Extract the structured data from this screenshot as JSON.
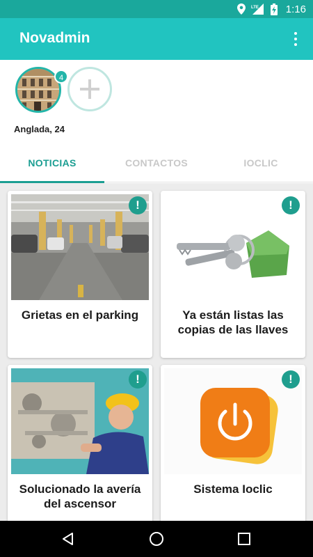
{
  "status_bar": {
    "time": "1:16",
    "network": "LTE",
    "icons": [
      "location-icon",
      "signal-icon",
      "battery-icon"
    ]
  },
  "app_bar": {
    "title": "Novadmin",
    "menu_icon": "overflow-menu-icon"
  },
  "buildings": [
    {
      "label": "Anglada, 24",
      "badge": "4"
    }
  ],
  "add_building_icon": "plus-icon",
  "tabs": [
    {
      "label": "NOTICIAS",
      "active": true
    },
    {
      "label": "CONTACTOS",
      "active": false
    },
    {
      "label": "IOCLIC",
      "active": false
    }
  ],
  "news": [
    {
      "title": "Grietas en el parking",
      "image": "parking-photo",
      "alert": "!"
    },
    {
      "title": "Ya están listas las copias de las llaves",
      "image": "keys-photo",
      "alert": "!"
    },
    {
      "title": "Solucionado la avería del ascensor",
      "image": "elevator-repair-photo",
      "alert": "!"
    },
    {
      "title": "Sistema Ioclic",
      "image": "power-logo",
      "alert": "!"
    }
  ],
  "colors": {
    "status_bar": "#1aa89c",
    "app_bar": "#21c4c0",
    "accent": "#1b9e92",
    "alert_badge": "#1f9e8e",
    "feed_background": "#ececec",
    "ioclic_orange": "#f07d16"
  },
  "nav_bar": {
    "icons": [
      "back-icon",
      "home-icon",
      "recents-icon"
    ]
  }
}
